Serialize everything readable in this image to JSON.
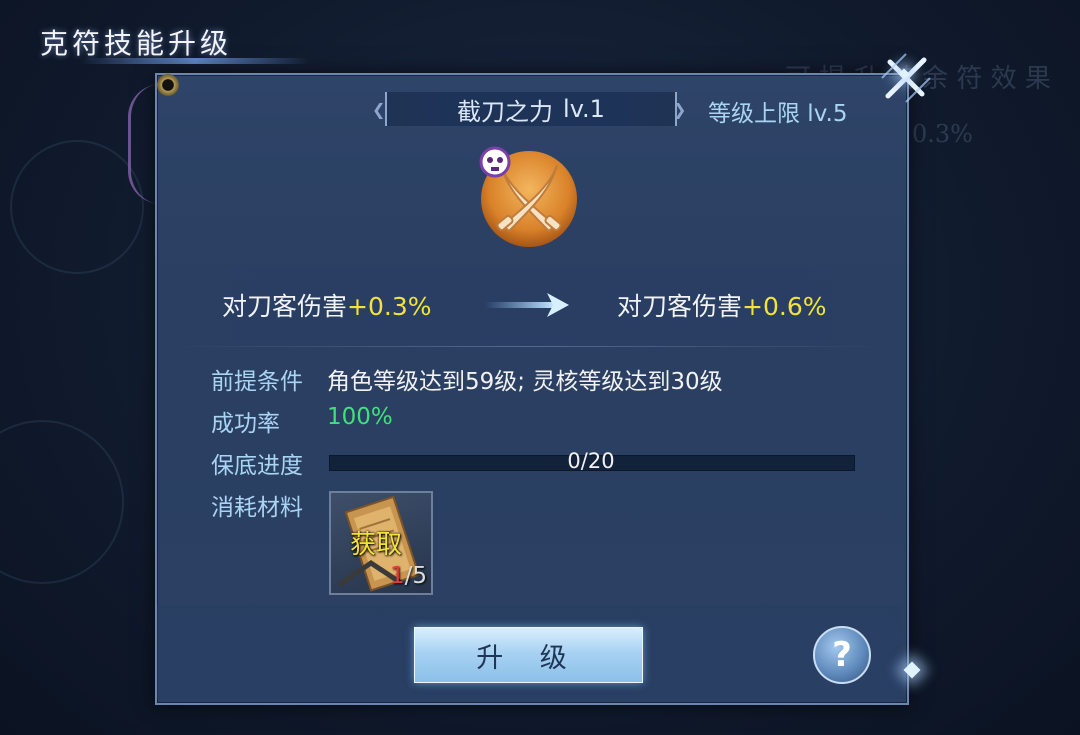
{
  "window": {
    "title": "克符技能升级"
  },
  "skill": {
    "name": "截刀之力",
    "level": "lv.1",
    "level_cap": "等级上限 lv.5"
  },
  "stats": {
    "current_label": "对刀客伤害",
    "current_value": "+0.3%",
    "next_label": "对刀客伤害",
    "next_value": "+0.6%"
  },
  "conditions": {
    "prerequisite_label": "前提条件",
    "prerequisite_value": "角色等级达到59级; 灵核等级达到30级",
    "success_label": "成功率",
    "success_value": "100%",
    "progress_label": "保底进度",
    "progress_text": "0/20",
    "progress_fraction": 0,
    "material_label": "消耗材料"
  },
  "material": {
    "action": "获取",
    "have": "1",
    "need": "/5"
  },
  "buttons": {
    "upgrade": "升 级",
    "help": "?"
  },
  "colors": {
    "accent_yellow": "#f3e23a",
    "success_green": "#3de37a",
    "label_blue": "#a9d4f2",
    "panel": "#2e4468"
  },
  "icons": [
    "close-icon",
    "skull-icon",
    "crossed-blades-icon",
    "arrow-right-icon",
    "scroll-item-icon",
    "help-icon"
  ]
}
